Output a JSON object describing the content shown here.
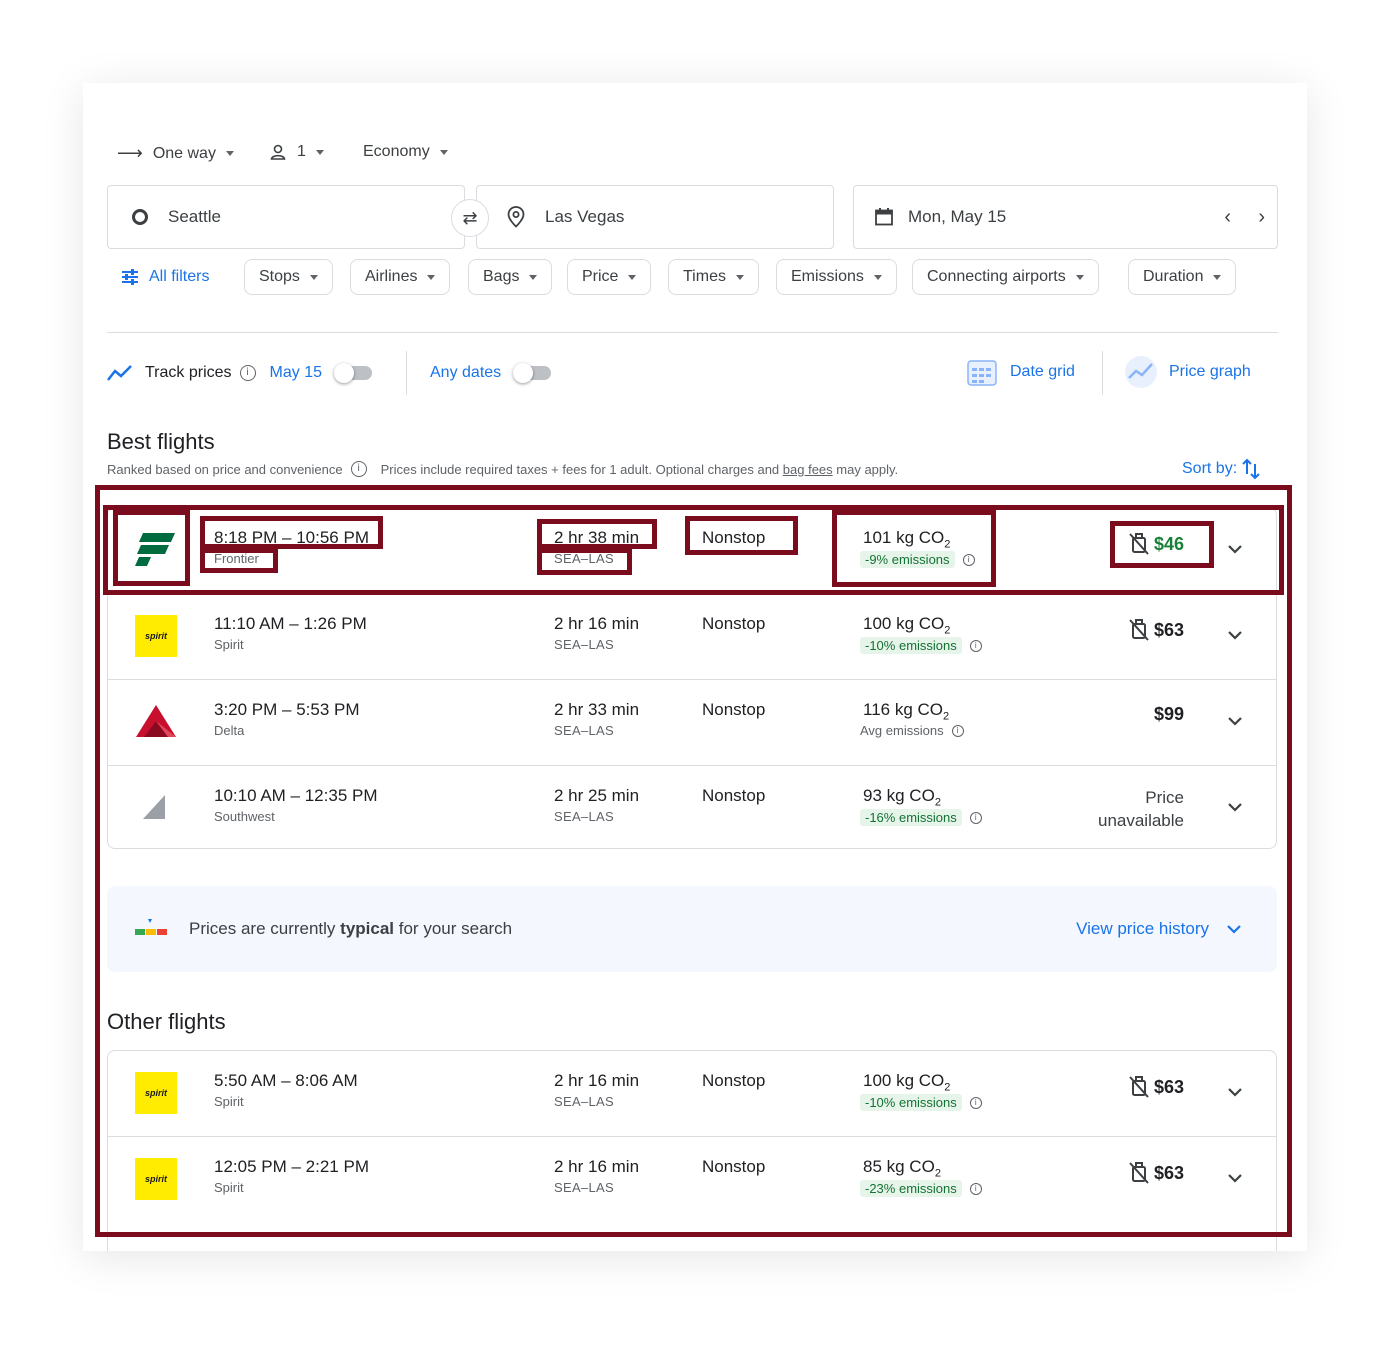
{
  "trip": {
    "type": "One way",
    "passengers": "1",
    "cabin": "Economy"
  },
  "search": {
    "origin": "Seattle",
    "destination": "Las Vegas",
    "date": "Mon, May 15"
  },
  "filters": [
    "All filters",
    "Stops",
    "Airlines",
    "Bags",
    "Price",
    "Times",
    "Emissions",
    "Connecting airports",
    "Duration"
  ],
  "track": {
    "label": "Track prices",
    "date": "May 15",
    "any_dates": "Any dates"
  },
  "tools": {
    "date_grid": "Date grid",
    "price_graph": "Price graph"
  },
  "best": {
    "title": "Best flights",
    "ranked_note": "Ranked based on price and convenience",
    "taxes_note_pre": "Prices include required taxes + fees for 1 adult. Optional charges and ",
    "bag_fees": "bag fees",
    "taxes_note_post": " may apply.",
    "sort_label": "Sort by:"
  },
  "best_flights": [
    {
      "times": "8:18 PM – 10:56 PM",
      "airline": "Frontier",
      "duration": "2 hr 38 min",
      "route": "SEA–LAS",
      "stops": "Nonstop",
      "co2_amount": "101 kg CO",
      "co2_sub": "2",
      "emissions": "-9% emissions",
      "emissions_style": "green",
      "price": "$46",
      "price_green": true,
      "no_bag": true,
      "logo": "frontier"
    },
    {
      "times": "11:10 AM – 1:26 PM",
      "airline": "Spirit",
      "duration": "2 hr 16 min",
      "route": "SEA–LAS",
      "stops": "Nonstop",
      "co2_amount": "100 kg CO",
      "co2_sub": "2",
      "emissions": "-10% emissions",
      "emissions_style": "green",
      "price": "$63",
      "price_green": false,
      "no_bag": true,
      "logo": "spirit"
    },
    {
      "times": "3:20 PM – 5:53 PM",
      "airline": "Delta",
      "duration": "2 hr 33 min",
      "route": "SEA–LAS",
      "stops": "Nonstop",
      "co2_amount": "116 kg CO",
      "co2_sub": "2",
      "emissions": "Avg emissions",
      "emissions_style": "plain",
      "price": "$99",
      "price_green": false,
      "no_bag": false,
      "logo": "delta"
    },
    {
      "times": "10:10 AM – 12:35 PM",
      "airline": "Southwest",
      "duration": "2 hr 25 min",
      "route": "SEA–LAS",
      "stops": "Nonstop",
      "co2_amount": "93 kg CO",
      "co2_sub": "2",
      "emissions": "-16% emissions",
      "emissions_style": "green",
      "price_line1": "Price",
      "price_line2": "unavailable",
      "price_green": false,
      "no_bag": false,
      "logo": "southwest"
    }
  ],
  "insight": {
    "pre": "Prices are currently ",
    "bold": "typical",
    "post": " for your search",
    "link": "View price history"
  },
  "other": {
    "title": "Other flights"
  },
  "other_flights": [
    {
      "times": "5:50 AM – 8:06 AM",
      "airline": "Spirit",
      "duration": "2 hr 16 min",
      "route": "SEA–LAS",
      "stops": "Nonstop",
      "co2_amount": "100 kg CO",
      "co2_sub": "2",
      "emissions": "-10% emissions",
      "emissions_style": "green",
      "price": "$63",
      "price_green": false,
      "no_bag": true,
      "logo": "spirit"
    },
    {
      "times": "12:05 PM – 2:21 PM",
      "airline": "Spirit",
      "duration": "2 hr 16 min",
      "route": "SEA–LAS",
      "stops": "Nonstop",
      "co2_amount": "85 kg CO",
      "co2_sub": "2",
      "emissions": "-23% emissions",
      "emissions_style": "green",
      "price": "$63",
      "price_green": false,
      "no_bag": true,
      "logo": "spirit"
    }
  ],
  "logo_text": {
    "spirit": "spirit"
  },
  "colors": {
    "accent": "#1a73e8",
    "green": "#188038",
    "annotation": "#7b0c1e",
    "spirit_yellow": "#ffec00",
    "frontier_green": "#006b3f",
    "delta_red": "#c8102e"
  }
}
